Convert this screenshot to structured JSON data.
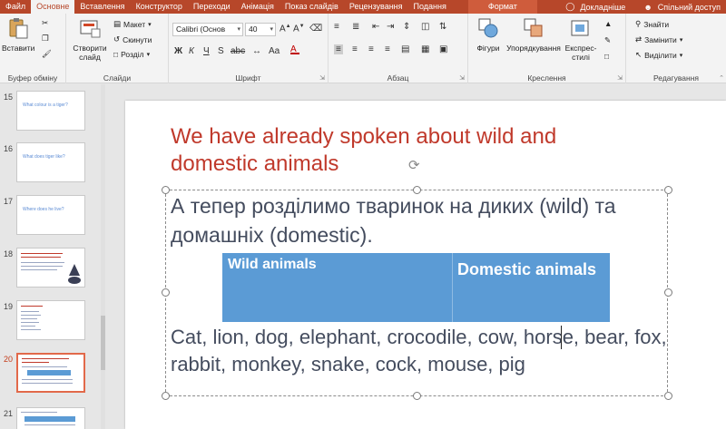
{
  "tabs": [
    {
      "label": "Файл"
    },
    {
      "label": "Основне",
      "active": true
    },
    {
      "label": "Вставлення"
    },
    {
      "label": "Конструктор"
    },
    {
      "label": "Переходи"
    },
    {
      "label": "Анімація"
    },
    {
      "label": "Показ слайдів"
    },
    {
      "label": "Рецензування"
    },
    {
      "label": "Подання"
    }
  ],
  "format_tab": "Формат",
  "tell_me": "Докладніше",
  "share": "Спільний доступ",
  "ribbon": {
    "clipboard": {
      "paste": "Вставити",
      "group": "Буфер обміну"
    },
    "slides": {
      "new_slide_line1": "Створити",
      "new_slide_line2": "слайд",
      "layout": "Макет",
      "reset": "Скинути",
      "section": "Розділ",
      "group": "Слайди"
    },
    "font": {
      "font_name": "Calibri (Основ",
      "font_size": "40",
      "group": "Шрифт"
    },
    "paragraph": {
      "group": "Абзац"
    },
    "drawing": {
      "shapes": "Фігури",
      "arrange": "Упорядкування",
      "quick_styles_line1": "Експрес-",
      "quick_styles_line2": "стилі",
      "group": "Креслення"
    },
    "editing": {
      "find": "Знайти",
      "replace": "Замінити",
      "select": "Виділити",
      "group": "Редагування"
    }
  },
  "thumbnails": [
    {
      "num": "15",
      "text": "What colour is a tiger?"
    },
    {
      "num": "16",
      "text": "What does tiger like?"
    },
    {
      "num": "17",
      "text": "Where does he live?"
    },
    {
      "num": "18",
      "text": ""
    },
    {
      "num": "19",
      "text": ""
    },
    {
      "num": "20",
      "text": "",
      "active": true
    },
    {
      "num": "21",
      "text": ""
    }
  ],
  "slide": {
    "title": "We have already spoken about wild and domestic animals",
    "body": "А тепер розділимо тваринок на диких (wild) та домашніх (domestic).",
    "table": {
      "col1": "Wild animals",
      "col2": "Domestic animals"
    },
    "animals": "Cat, lion, dog, elephant, crocodile, cow, horse, bear, fox, rabbit, monkey, snake, cock, mouse, pig"
  },
  "colors": {
    "accent": "#b7472a",
    "title": "#c0392b",
    "table": "#5b9bd5",
    "body": "#444c5e"
  }
}
